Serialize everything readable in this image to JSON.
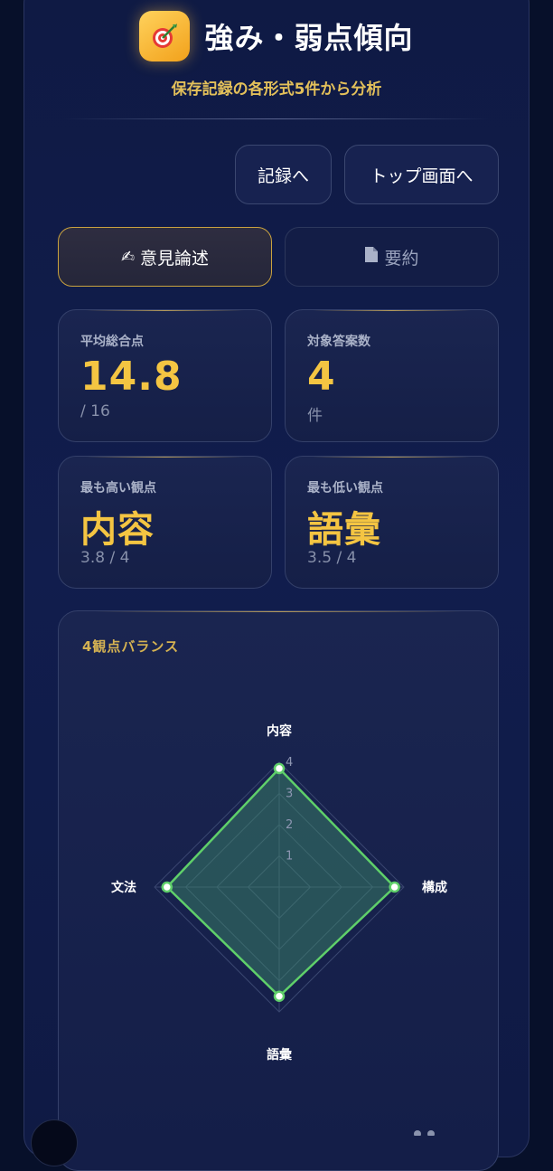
{
  "header": {
    "title": "強み・弱点傾向",
    "subtitle": "保存記録の各形式5件から分析",
    "icon": "dart-target-icon"
  },
  "nav": {
    "records_label": "記録へ",
    "top_label": "トップ画面へ"
  },
  "tabs": [
    {
      "label": "意見論述",
      "icon": "writing-hand-icon",
      "active": true
    },
    {
      "label": "要約",
      "icon": "document-icon",
      "active": false
    }
  ],
  "stats": {
    "average": {
      "label": "平均総合点",
      "value": "14.8",
      "sub": "/ 16"
    },
    "count": {
      "label": "対象答案数",
      "value": "4",
      "sub": "件"
    },
    "highest": {
      "label": "最も高い観点",
      "value": "内容",
      "sub": "3.8 / 4"
    },
    "lowest": {
      "label": "最も低い観点",
      "value": "語彙",
      "sub": "3.5 / 4"
    }
  },
  "chart_data": {
    "type": "radar",
    "title": "4観点バランス",
    "axes": [
      "内容",
      "構成",
      "語彙",
      "文法"
    ],
    "values": [
      3.8,
      3.7,
      3.5,
      3.6
    ],
    "range": [
      0,
      4
    ],
    "ticks": [
      "1",
      "2",
      "3",
      "4"
    ],
    "colors": {
      "line": "#5fcf6a",
      "fill": "#3e8f6a",
      "grid": "#3a4670",
      "point": "#ffffff"
    }
  }
}
